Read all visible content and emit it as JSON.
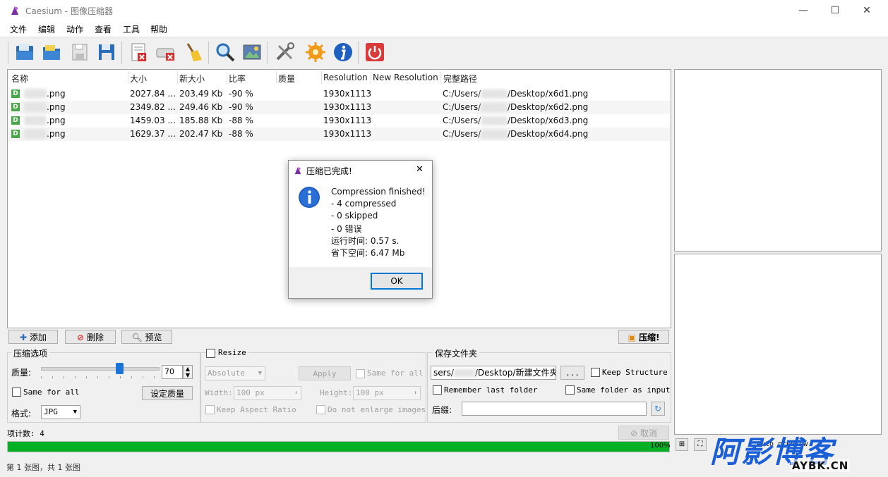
{
  "window": {
    "title": "Caesium - 图像压缩器",
    "minimize": "—",
    "maximize": "☐",
    "close": "✕"
  },
  "menu": [
    "文件",
    "编辑",
    "动作",
    "查看",
    "工具",
    "帮助"
  ],
  "toolbar_icons": [
    "open-files-icon",
    "open-folder-icon",
    "save-icon",
    "save-as-icon",
    "remove-item-icon",
    "clear-list-icon",
    "clean-icon",
    "preview-icon",
    "image-preview-icon",
    "settings-icon",
    "plugins-icon",
    "info-icon",
    "exit-icon"
  ],
  "file_list": {
    "columns": [
      "名称",
      "大小",
      "新大小",
      "比率",
      "质量",
      "Resolution",
      "New Resolution",
      "完整路径"
    ],
    "rows": [
      {
        "badge": "D",
        "name": ".png",
        "size": "2027.84 ...",
        "new_size": "203.49 Kb",
        "ratio": "-90 %",
        "quality": "",
        "resolution": "1930x1113",
        "new_resolution": "",
        "path_prefix": "C:/Users/",
        "path_suffix": "/Desktop/x6d1.png"
      },
      {
        "badge": "D",
        "name": ".png",
        "size": "2349.82 ...",
        "new_size": "249.46 Kb",
        "ratio": "-90 %",
        "quality": "",
        "resolution": "1930x1113",
        "new_resolution": "",
        "path_prefix": "C:/Users/",
        "path_suffix": "/Desktop/x6d2.png"
      },
      {
        "badge": "D",
        "name": ".png",
        "size": "1459.03 ...",
        "new_size": "185.88 Kb",
        "ratio": "-88 %",
        "quality": "",
        "resolution": "1930x1113",
        "new_resolution": "",
        "path_prefix": "C:/Users/",
        "path_suffix": "/Desktop/x6d3.png"
      },
      {
        "badge": "D",
        "name": ".png",
        "size": "1629.37 ...",
        "new_size": "202.47 Kb",
        "ratio": "-88 %",
        "quality": "",
        "resolution": "1930x1113",
        "new_resolution": "",
        "path_prefix": "C:/Users/",
        "path_suffix": "/Desktop/x6d4.png"
      }
    ]
  },
  "list_buttons": {
    "add": "添加",
    "remove": "删除",
    "preview": "预览",
    "compress": "压缩!"
  },
  "compression": {
    "legend": "压缩选项",
    "quality_label": "质量:",
    "quality_value": "70",
    "same_for_all": "Same for all",
    "set_quality": "设定质量",
    "format_label": "格式:",
    "format_value": "JPG"
  },
  "resize": {
    "legend": "Resize",
    "mode": "Absolute",
    "apply": "Apply",
    "same_for_all": "Same for all",
    "width_label": "Width:",
    "width_value": "100 px",
    "height_label": "Height:",
    "height_value": "100 px",
    "keep_aspect": "Keep Aspect Ratio",
    "no_enlarge": "Do not enlarge images"
  },
  "save_folder": {
    "legend": "保存文件夹",
    "path_prefix": "sers/",
    "path_suffix": "/Desktop/新建文件夹",
    "browse": "...",
    "keep_structure": "Keep Structure",
    "remember_last": "Remember last folder",
    "same_as_input": "Same folder as input",
    "suffix_label": "后缀:",
    "suffix_value": ""
  },
  "status": {
    "item_count": "项计数: 4",
    "cancel": "取消",
    "progress": 1.0,
    "progress_label": "100%",
    "footer": "第 1 张图，共 1 张图"
  },
  "preview_panel": {
    "auto_preview": "Auto preview"
  },
  "dialog": {
    "title": "压缩已完成!",
    "close": "✕",
    "lines": [
      "Compression finished!",
      "- 4 compressed",
      "- 0 skipped",
      "- 0 错误",
      "运行时间: 0.57 s.",
      "省下空间: 6.47 Mb"
    ],
    "ok": "OK"
  },
  "watermark": {
    "main": "阿影博客",
    "sub": "AYBK.CN"
  },
  "colors": {
    "progress": "#06b025",
    "accent_blue": "#0078d7",
    "watermark_blue": "#1a5fd6"
  }
}
